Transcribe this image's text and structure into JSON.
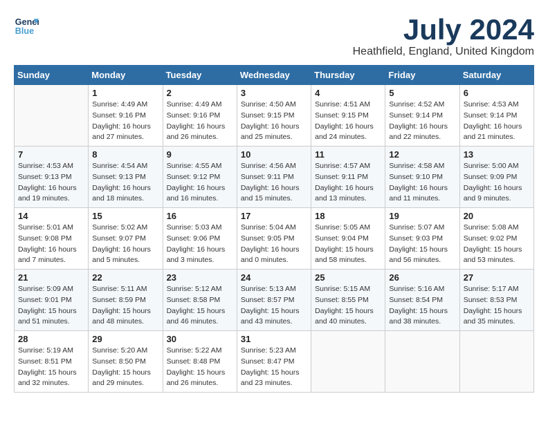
{
  "header": {
    "logo_line1": "General",
    "logo_line2": "Blue",
    "month_title": "July 2024",
    "location": "Heathfield, England, United Kingdom"
  },
  "weekdays": [
    "Sunday",
    "Monday",
    "Tuesday",
    "Wednesday",
    "Thursday",
    "Friday",
    "Saturday"
  ],
  "weeks": [
    [
      {
        "day": "",
        "info": ""
      },
      {
        "day": "1",
        "info": "Sunrise: 4:49 AM\nSunset: 9:16 PM\nDaylight: 16 hours\nand 27 minutes."
      },
      {
        "day": "2",
        "info": "Sunrise: 4:49 AM\nSunset: 9:16 PM\nDaylight: 16 hours\nand 26 minutes."
      },
      {
        "day": "3",
        "info": "Sunrise: 4:50 AM\nSunset: 9:15 PM\nDaylight: 16 hours\nand 25 minutes."
      },
      {
        "day": "4",
        "info": "Sunrise: 4:51 AM\nSunset: 9:15 PM\nDaylight: 16 hours\nand 24 minutes."
      },
      {
        "day": "5",
        "info": "Sunrise: 4:52 AM\nSunset: 9:14 PM\nDaylight: 16 hours\nand 22 minutes."
      },
      {
        "day": "6",
        "info": "Sunrise: 4:53 AM\nSunset: 9:14 PM\nDaylight: 16 hours\nand 21 minutes."
      }
    ],
    [
      {
        "day": "7",
        "info": "Sunrise: 4:53 AM\nSunset: 9:13 PM\nDaylight: 16 hours\nand 19 minutes."
      },
      {
        "day": "8",
        "info": "Sunrise: 4:54 AM\nSunset: 9:13 PM\nDaylight: 16 hours\nand 18 minutes."
      },
      {
        "day": "9",
        "info": "Sunrise: 4:55 AM\nSunset: 9:12 PM\nDaylight: 16 hours\nand 16 minutes."
      },
      {
        "day": "10",
        "info": "Sunrise: 4:56 AM\nSunset: 9:11 PM\nDaylight: 16 hours\nand 15 minutes."
      },
      {
        "day": "11",
        "info": "Sunrise: 4:57 AM\nSunset: 9:11 PM\nDaylight: 16 hours\nand 13 minutes."
      },
      {
        "day": "12",
        "info": "Sunrise: 4:58 AM\nSunset: 9:10 PM\nDaylight: 16 hours\nand 11 minutes."
      },
      {
        "day": "13",
        "info": "Sunrise: 5:00 AM\nSunset: 9:09 PM\nDaylight: 16 hours\nand 9 minutes."
      }
    ],
    [
      {
        "day": "14",
        "info": "Sunrise: 5:01 AM\nSunset: 9:08 PM\nDaylight: 16 hours\nand 7 minutes."
      },
      {
        "day": "15",
        "info": "Sunrise: 5:02 AM\nSunset: 9:07 PM\nDaylight: 16 hours\nand 5 minutes."
      },
      {
        "day": "16",
        "info": "Sunrise: 5:03 AM\nSunset: 9:06 PM\nDaylight: 16 hours\nand 3 minutes."
      },
      {
        "day": "17",
        "info": "Sunrise: 5:04 AM\nSunset: 9:05 PM\nDaylight: 16 hours\nand 0 minutes."
      },
      {
        "day": "18",
        "info": "Sunrise: 5:05 AM\nSunset: 9:04 PM\nDaylight: 15 hours\nand 58 minutes."
      },
      {
        "day": "19",
        "info": "Sunrise: 5:07 AM\nSunset: 9:03 PM\nDaylight: 15 hours\nand 56 minutes."
      },
      {
        "day": "20",
        "info": "Sunrise: 5:08 AM\nSunset: 9:02 PM\nDaylight: 15 hours\nand 53 minutes."
      }
    ],
    [
      {
        "day": "21",
        "info": "Sunrise: 5:09 AM\nSunset: 9:01 PM\nDaylight: 15 hours\nand 51 minutes."
      },
      {
        "day": "22",
        "info": "Sunrise: 5:11 AM\nSunset: 8:59 PM\nDaylight: 15 hours\nand 48 minutes."
      },
      {
        "day": "23",
        "info": "Sunrise: 5:12 AM\nSunset: 8:58 PM\nDaylight: 15 hours\nand 46 minutes."
      },
      {
        "day": "24",
        "info": "Sunrise: 5:13 AM\nSunset: 8:57 PM\nDaylight: 15 hours\nand 43 minutes."
      },
      {
        "day": "25",
        "info": "Sunrise: 5:15 AM\nSunset: 8:55 PM\nDaylight: 15 hours\nand 40 minutes."
      },
      {
        "day": "26",
        "info": "Sunrise: 5:16 AM\nSunset: 8:54 PM\nDaylight: 15 hours\nand 38 minutes."
      },
      {
        "day": "27",
        "info": "Sunrise: 5:17 AM\nSunset: 8:53 PM\nDaylight: 15 hours\nand 35 minutes."
      }
    ],
    [
      {
        "day": "28",
        "info": "Sunrise: 5:19 AM\nSunset: 8:51 PM\nDaylight: 15 hours\nand 32 minutes."
      },
      {
        "day": "29",
        "info": "Sunrise: 5:20 AM\nSunset: 8:50 PM\nDaylight: 15 hours\nand 29 minutes."
      },
      {
        "day": "30",
        "info": "Sunrise: 5:22 AM\nSunset: 8:48 PM\nDaylight: 15 hours\nand 26 minutes."
      },
      {
        "day": "31",
        "info": "Sunrise: 5:23 AM\nSunset: 8:47 PM\nDaylight: 15 hours\nand 23 minutes."
      },
      {
        "day": "",
        "info": ""
      },
      {
        "day": "",
        "info": ""
      },
      {
        "day": "",
        "info": ""
      }
    ]
  ]
}
